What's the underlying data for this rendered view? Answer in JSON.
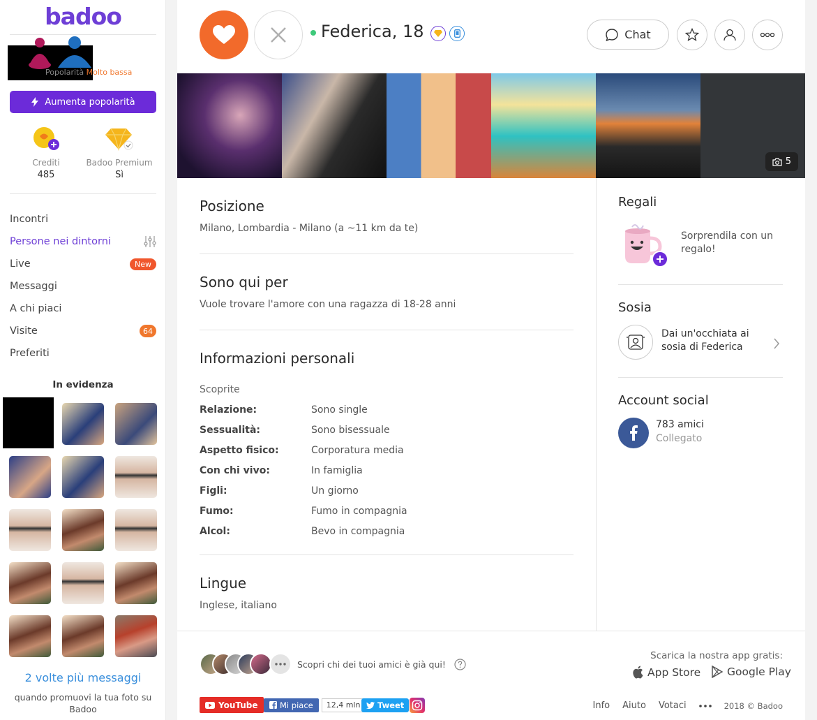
{
  "sidebar": {
    "logo": "badoo",
    "popularity_label": "Popolarità",
    "popularity_value": "Molto bassa",
    "boost_label": "Aumenta popolarità",
    "credits_label": "Crediti",
    "credits_value": "485",
    "premium_label": "Badoo Premium",
    "premium_value": "Sì",
    "nav": [
      {
        "label": "Incontri"
      },
      {
        "label": "Persone nei dintorni"
      },
      {
        "label": "Live",
        "badge": "New"
      },
      {
        "label": "Messaggi"
      },
      {
        "label": "A chi piaci"
      },
      {
        "label": "Visite",
        "badge": "64"
      },
      {
        "label": "Preferiti"
      }
    ],
    "featured_title": "In evidenza",
    "promo_title": "2 volte più messaggi",
    "promo_sub": "quando promuovi la tua foto su Badoo"
  },
  "profile": {
    "name": "Federica, 18",
    "chat_label": "Chat",
    "photo_count": "5"
  },
  "sections": {
    "position_title": "Posizione",
    "position_text": "Milano, Lombardia - Milano (a ~11 km da te)",
    "here_for_title": "Sono qui per",
    "here_for_text": "Vuole trovare l'amore con una ragazza di 18-28 anni",
    "personal_title": "Informazioni personali",
    "personal_sub": "Scoprite",
    "personal_rows": [
      {
        "k": "Relazione:",
        "v": "Sono single"
      },
      {
        "k": "Sessualità:",
        "v": "Sono bisessuale"
      },
      {
        "k": "Aspetto fisico:",
        "v": "Corporatura media"
      },
      {
        "k": "Con chi vivo:",
        "v": "In famiglia"
      },
      {
        "k": "Figli:",
        "v": "Un giorno"
      },
      {
        "k": "Fumo:",
        "v": "Fumo in compagnia"
      },
      {
        "k": "Alcol:",
        "v": "Bevo in compagnia"
      }
    ],
    "languages_title": "Lingue",
    "languages_text": "Inglese, italiano"
  },
  "right": {
    "gifts_title": "Regali",
    "gifts_text": "Sorprendila con un regalo!",
    "lookalike_title": "Sosia",
    "lookalike_text": "Dai un'occhiata ai sosia di Federica",
    "social_title": "Account social",
    "friends_count": "783 amici",
    "connected": "Collegato"
  },
  "footer": {
    "friends_text": "Scopri chi dei tuoi amici è già qui!",
    "store_title": "Scarica la nostra app gratis:",
    "app_store": "App Store",
    "google_play": "Google Play",
    "youtube": "YouTube",
    "fb_like": "Mi piace",
    "fb_count": "12,4 mln",
    "tweet": "Tweet",
    "links": [
      "Info",
      "Aiuto",
      "Votaci"
    ],
    "copyright": "2018 © Badoo"
  },
  "colors": {
    "brand": "#6e3fd6",
    "like": "#f26a2b",
    "accent_orange": "#f0772d",
    "link_blue": "#3a8fdc"
  }
}
